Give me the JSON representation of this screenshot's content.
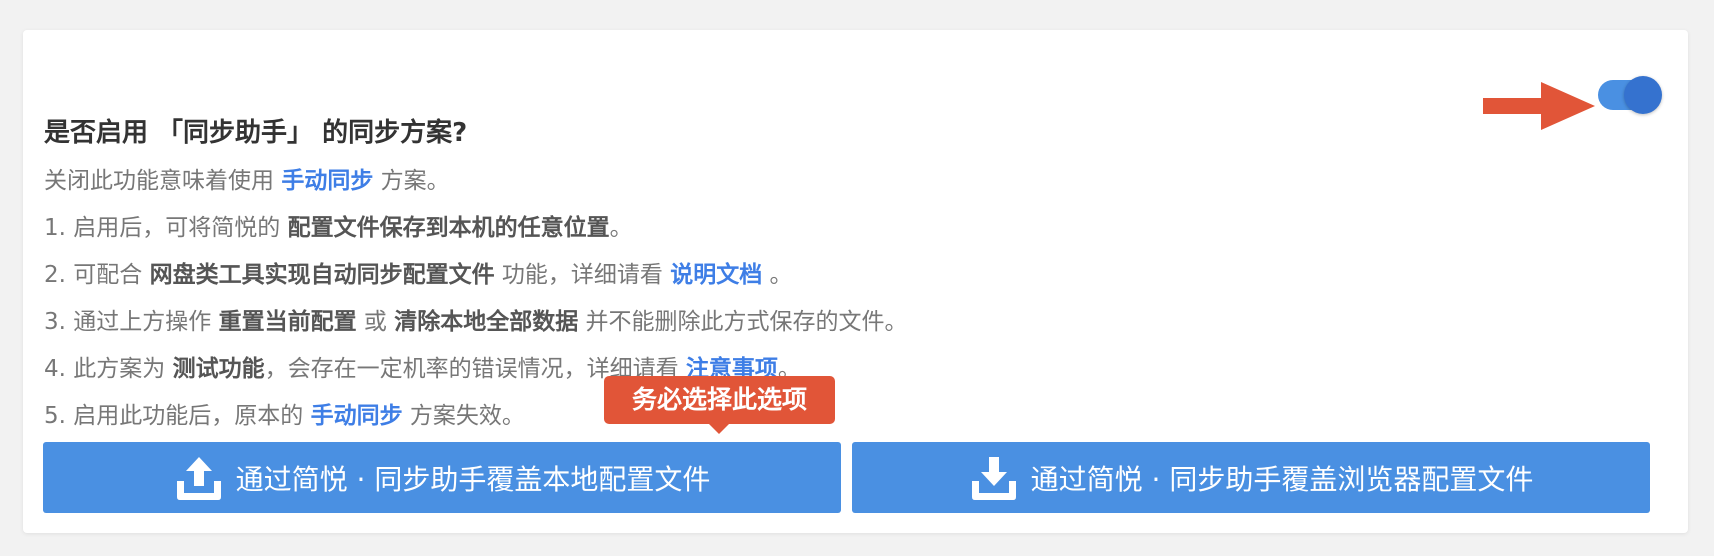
{
  "title": "是否启用 「同步助手」 的同步方案?",
  "toggle": {
    "state": "on",
    "color": "#4a90e2"
  },
  "description": {
    "intro": {
      "pre": "关闭此功能意味着使用 ",
      "link": "手动同步",
      "post": " 方案。"
    },
    "item1": {
      "pre": "1. 启用后，可将简悦的 ",
      "bold": "配置文件保存到本机的任意位置",
      "post": "。"
    },
    "item2": {
      "pre": "2. 可配合 ",
      "bold": "网盘类工具实现自动同步配置文件",
      "mid": " 功能，详细请看 ",
      "link": "说明文档",
      "post": " 。"
    },
    "item3": {
      "pre": "3. 通过上方操作 ",
      "bold1": "重置当前配置",
      "mid": " 或 ",
      "bold2": "清除本地全部数据",
      "post": " 并不能删除此方式保存的文件。"
    },
    "item4": {
      "pre": "4. 此方案为 ",
      "bold": "测试功能",
      "mid": "，会存在一定机率的错误情况，详细请看 ",
      "link": "注意事项",
      "post": "。"
    },
    "item5": {
      "pre": "5. 启用此功能后，原本的 ",
      "link": "手动同步",
      "post": " 方案失效。"
    }
  },
  "tooltip": {
    "text": "务必选择此选项",
    "color": "#e15538"
  },
  "buttons": {
    "upload": {
      "label": "通过简悦 · 同步助手覆盖本地配置文件",
      "icon": "upload-icon"
    },
    "download": {
      "label": "通过简悦 · 同步助手覆盖浏览器配置文件",
      "icon": "download-icon"
    }
  },
  "colors": {
    "accent": "#4a90e2",
    "link": "#3e7ee6",
    "annotation": "#e15538"
  }
}
